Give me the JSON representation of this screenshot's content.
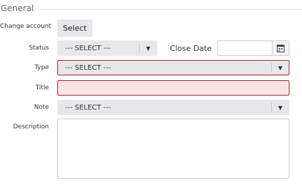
{
  "section": {
    "title": "General"
  },
  "fields": {
    "change_account": {
      "label": "Change account",
      "button_label": "Select"
    },
    "status": {
      "label": "Status",
      "value": "--- SELECT ---"
    },
    "close_date": {
      "label": "Close Date",
      "value": ""
    },
    "type": {
      "label": "Type",
      "value": "--- SELECT ---"
    },
    "title": {
      "label": "Title",
      "value": ""
    },
    "note": {
      "label": "Note",
      "value": "--- SELECT ---"
    },
    "description": {
      "label": "Description",
      "value": ""
    }
  },
  "icons": {
    "caret": "▼",
    "calendar": "calendar-icon"
  },
  "colors": {
    "invalid_border": "#a6262b",
    "invalid_fill": "#fde4e4",
    "select_bg": "#e6e8eb"
  }
}
